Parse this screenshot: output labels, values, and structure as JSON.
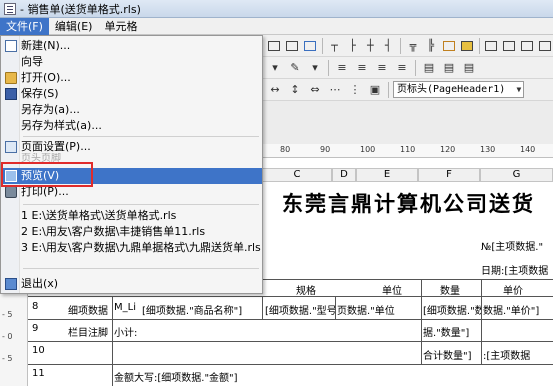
{
  "window": {
    "title": "- 销售单(送货单格式.rls)"
  },
  "menubar": {
    "file": "文件(F)",
    "edit": "编辑(E)",
    "cell": "单元格"
  },
  "file_menu": {
    "new": "新建(N)...",
    "wizard": "向导",
    "open": "打开(O)...",
    "save": "保存(S)",
    "save_as": "另存为(a)...",
    "save_as_style": "另存为样式(a)...",
    "page_setup": "页面设置(P)...",
    "page_header": "页头页脚",
    "preview": "预览(V)",
    "print": "打印(P)...",
    "recent1": "1 E:\\送货单格式\\送货单格式.rls",
    "recent2": "2 E:\\用友\\客户数据\\丰捷销售单11.rls",
    "recent3": "3 E:\\用友\\客户数据\\九鼎单据格式\\九鼎送货单.rls",
    "exit": "退出(x)"
  },
  "toolbar": {
    "section_select": "页标头(PageHeader1)"
  },
  "ruler": {
    "marks": [
      "80",
      "90",
      "100",
      "110",
      "120",
      "130",
      "140"
    ]
  },
  "columns": {
    "c": "C",
    "d": "D",
    "e": "E",
    "f": "F",
    "g": "G"
  },
  "document": {
    "title": "东莞言鼎计算机公司送货",
    "no_label": "№[主项数据.\"",
    "date_label": "日期:[主项数据",
    "header_spec": "规格",
    "header_unit": "单位",
    "header_qty": "数量",
    "header_price": "单价"
  },
  "rows": [
    {
      "num": "8",
      "band": "细项数据",
      "c1": "M_Li",
      "c2": "[细项数据.\"商品名称\"]",
      "c3": "[细项数据.\"型号\"]",
      "c4": "页数据.\"单位",
      "c5": "[细项数据.\"数量\"]",
      "c6": "数据.\"单价\"]"
    },
    {
      "num": "9",
      "band": "栏目注脚",
      "c1": "小计:",
      "c5": "据.\"数量\"]"
    },
    {
      "num": "10",
      "c5": "合计数量\"]",
      "c6": ":[主项数据"
    },
    {
      "num": "11",
      "c1": "金额大写:[细项数据.\"金额\"]"
    }
  ],
  "left_ruler": [
    "1",
    "- 5",
    "- 0",
    "- 5"
  ]
}
